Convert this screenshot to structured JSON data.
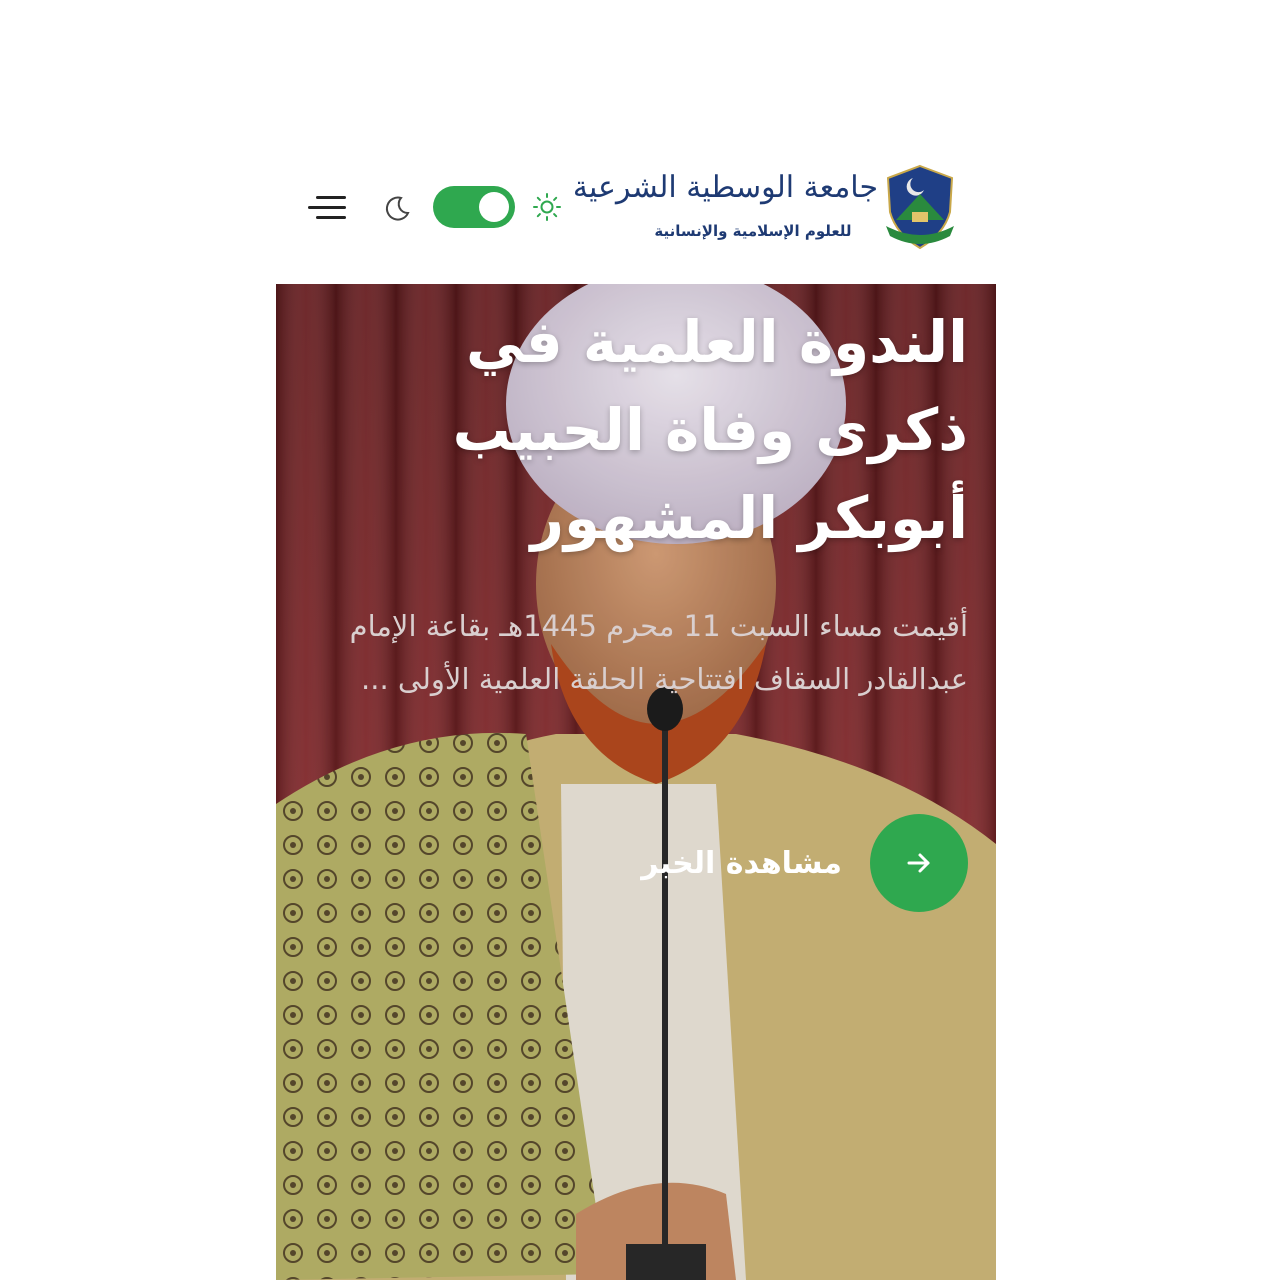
{
  "header": {
    "logo": {
      "title": "جامعة الوسطية الشرعية",
      "subtitle": "للعلوم الإسلامية والإنسانية"
    },
    "menu_icon": "hamburger-menu-icon",
    "theme_toggle": {
      "left_icon": "moon-icon",
      "right_icon": "sun-icon",
      "state": "on",
      "color": "#2fa84f"
    }
  },
  "hero": {
    "title": "الندوة العلمية في ذكرى وفاة الحبيب أبوبكر المشهور",
    "excerpt": "أقيمت مساء السبت 11 محرم 1445هـ بقاعة الإمام عبدالقادر السقاف افتتاحية الحلقة العلمية الأولى ...",
    "cta_label": "مشاهدة الخبر",
    "cta_icon": "arrow-right-icon",
    "accent_color": "#2fa84f"
  }
}
